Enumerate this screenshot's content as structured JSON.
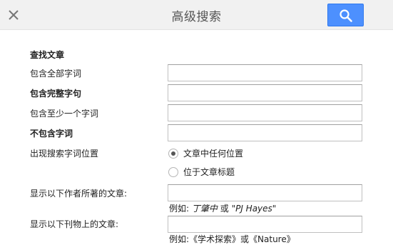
{
  "header": {
    "title": "高级搜索",
    "close_icon": "close-icon",
    "search_icon": "search-icon",
    "accent_color": "#4d90fe"
  },
  "form": {
    "section_title": "查找文章",
    "all_words_label": "包含全部字词",
    "exact_phrase_label": "包含完整字句",
    "at_least_one_label": "包含至少一个字词",
    "without_words_label": "不包含字词",
    "occurrence_label": "出现搜索字词位置",
    "occurrence_options": [
      {
        "label": "文章中任何位置",
        "selected": true
      },
      {
        "label": "位于文章标题",
        "selected": false
      }
    ],
    "author_label": "显示以下作者所著的文章:",
    "author_hint_prefix": "例如:",
    "author_hint_example_1": "丁肇中",
    "author_hint_or": "或",
    "author_hint_example_2": "\"PJ Hayes\"",
    "publication_label": "显示以下刊物上的文章:",
    "publication_hint": "例如:《学术探索》或《Nature》"
  }
}
